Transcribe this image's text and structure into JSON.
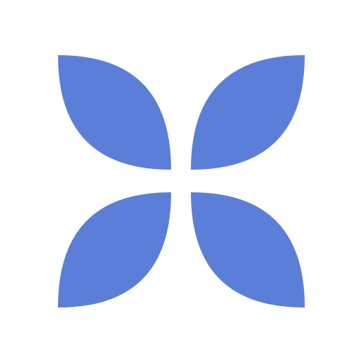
{
  "logo": {
    "icon": "four-petal-flower-logo-icon",
    "petal_color": "#5b7fd8",
    "background_color": "#ffffff"
  }
}
